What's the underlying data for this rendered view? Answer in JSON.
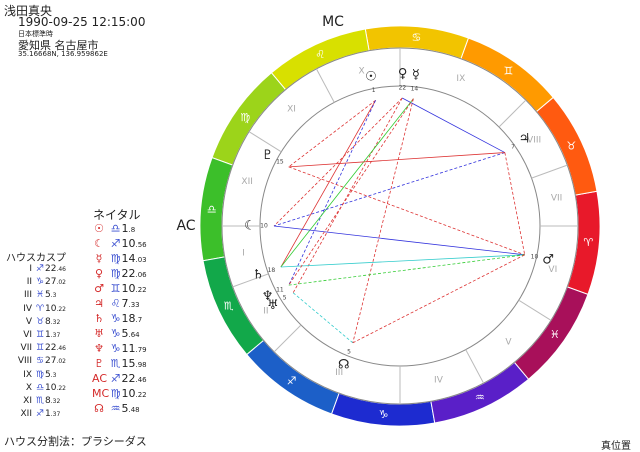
{
  "header": {
    "name": "浅田真央",
    "datetime": "1990-09-25 12:15:00",
    "timezone": "日本標準時",
    "place": "愛知県 名古屋市",
    "coords": "35.16668N, 136.959862E"
  },
  "natal": {
    "title": "ネイタル",
    "rows": [
      {
        "planet": "☉",
        "sign": "♎",
        "deg": "1",
        "min": ".8"
      },
      {
        "planet": "☾",
        "sign": "♐",
        "deg": "10",
        "min": ".56"
      },
      {
        "planet": "☿",
        "sign": "♍",
        "deg": "14",
        "min": ".03"
      },
      {
        "planet": "♀",
        "sign": "♍",
        "deg": "22",
        "min": ".06"
      },
      {
        "planet": "♂",
        "sign": "♊",
        "deg": "10",
        "min": ".22"
      },
      {
        "planet": "♃",
        "sign": "♌",
        "deg": "7",
        "min": ".33"
      },
      {
        "planet": "♄",
        "sign": "♑",
        "deg": "18",
        "min": ".7"
      },
      {
        "planet": "♅",
        "sign": "♑",
        "deg": "5",
        "min": ".64"
      },
      {
        "planet": "♆",
        "sign": "♑",
        "deg": "11",
        "min": ".79"
      },
      {
        "planet": "♇",
        "sign": "♏",
        "deg": "15",
        "min": ".98"
      },
      {
        "planet": "AC",
        "sign": "♐",
        "deg": "22",
        "min": ".46"
      },
      {
        "planet": "MC",
        "sign": "♍",
        "deg": "10",
        "min": ".22"
      },
      {
        "planet": "☊",
        "sign": "♒",
        "deg": "5",
        "min": ".48"
      }
    ]
  },
  "houses": {
    "title": "ハウスカスプ",
    "rows": [
      {
        "n": "I",
        "sign": "♐",
        "deg": "22",
        "min": ".46"
      },
      {
        "n": "II",
        "sign": "♑",
        "deg": "27",
        "min": ".02"
      },
      {
        "n": "III",
        "sign": "♓",
        "deg": "5",
        "min": ".3"
      },
      {
        "n": "IV",
        "sign": "♈",
        "deg": "10",
        "min": ".22"
      },
      {
        "n": "V",
        "sign": "♉",
        "deg": "8",
        "min": ".32"
      },
      {
        "n": "VI",
        "sign": "♊",
        "deg": "1",
        "min": ".37"
      },
      {
        "n": "VII",
        "sign": "♊",
        "deg": "22",
        "min": ".46"
      },
      {
        "n": "VIII",
        "sign": "♋",
        "deg": "27",
        "min": ".02"
      },
      {
        "n": "IX",
        "sign": "♍",
        "deg": "5",
        "min": ".3"
      },
      {
        "n": "X",
        "sign": "♎",
        "deg": "10",
        "min": ".22"
      },
      {
        "n": "XI",
        "sign": "♏",
        "deg": "8",
        "min": ".32"
      },
      {
        "n": "XII",
        "sign": "♐",
        "deg": "1",
        "min": ".37"
      }
    ]
  },
  "wheel": {
    "mc_label": "MC",
    "ac_label": "AC",
    "sign_colors": [
      "#e8192a",
      "#ff5a10",
      "#ff9a00",
      "#f2c400",
      "#d8e000",
      "#9cd41a",
      "#3cbf2a",
      "#12a84a",
      "#1c5fc8",
      "#1d2bd0",
      "#5a1fc8",
      "#a8105a"
    ],
    "house_numerals": [
      "I",
      "II",
      "III",
      "IV",
      "V",
      "VI",
      "VII",
      "VIII",
      "IX",
      "X",
      "XI",
      "XII"
    ],
    "planet_glyphs": [
      {
        "glyph": "☉",
        "deg": "1"
      },
      {
        "glyph": "♀",
        "deg": "22"
      },
      {
        "glyph": "☿",
        "deg": "14"
      },
      {
        "glyph": "♃",
        "deg": "7"
      },
      {
        "glyph": "☾",
        "deg": "10"
      },
      {
        "glyph": "♇",
        "deg": "15"
      },
      {
        "glyph": "♄",
        "deg": "18"
      },
      {
        "glyph": "♆",
        "deg": "11"
      },
      {
        "glyph": "♅",
        "deg": "5"
      },
      {
        "glyph": "☊",
        "deg": "5"
      },
      {
        "glyph": "♂",
        "deg": "10"
      }
    ]
  },
  "footer": {
    "house_system": "ハウス分割法：プラシーダス",
    "position_mode": "真位置"
  }
}
